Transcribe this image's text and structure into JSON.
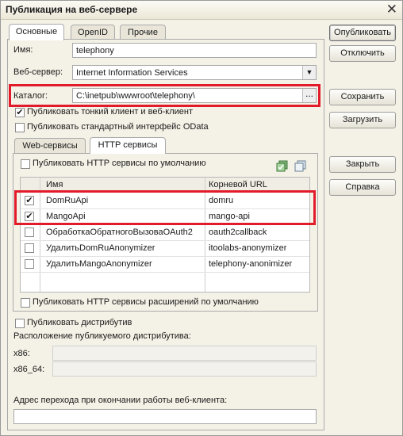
{
  "window": {
    "title": "Публикация на веб-сервере",
    "close_symbol": "✕"
  },
  "tabs": [
    {
      "label": "Основные",
      "active": true
    },
    {
      "label": "OpenID",
      "active": false
    },
    {
      "label": "Прочие",
      "active": false
    }
  ],
  "form": {
    "name_label": "Имя:",
    "name_value": "telephony",
    "webserver_label": "Веб-сервер:",
    "webserver_value": "Internet Information Services",
    "catalog_label": "Каталог:",
    "catalog_value": "C:\\inetpub\\wwwroot\\telephony\\",
    "ellipsis": "...",
    "publish_thin_client": {
      "label": "Публиковать тонкий клиент и веб-клиент",
      "checked": true
    },
    "publish_odata": {
      "label": "Публиковать стандартный интерфейс OData",
      "checked": false
    }
  },
  "inner_tabs": [
    {
      "label": "Web-сервисы",
      "active": false
    },
    {
      "label": "HTTP сервисы",
      "active": true
    }
  ],
  "http": {
    "publish_default": {
      "label": "Публиковать HTTP сервисы по умолчанию",
      "checked": false
    },
    "columns": {
      "name": "Имя",
      "root_url": "Корневой URL"
    },
    "rows": [
      {
        "checked": true,
        "name": "DomRuApi",
        "url": "domru"
      },
      {
        "checked": true,
        "name": "MangoApi",
        "url": "mango-api"
      },
      {
        "checked": false,
        "name": "ОбработкаОбратногоВызоваOAuth2",
        "url": "oauth2callback"
      },
      {
        "checked": false,
        "name": "УдалитьDomRuAnonymizer",
        "url": "itoolabs-anonymizer"
      },
      {
        "checked": false,
        "name": "УдалитьMangoAnonymizer",
        "url": "telephony-anonimizer"
      }
    ],
    "publish_ext_default": {
      "label": "Публиковать HTTP сервисы расширений по умолчанию",
      "checked": false
    }
  },
  "distrib": {
    "publish": {
      "label": "Публиковать дистрибутив",
      "checked": false
    },
    "location_label": "Расположение публикуемого дистрибутива:",
    "x86_label": "x86:",
    "x86_value": "",
    "x86_64_label": "x86_64:",
    "x86_64_value": ""
  },
  "exit_url": {
    "label": "Адрес перехода при окончании работы веб-клиента:",
    "value": ""
  },
  "buttons": {
    "publish": "Опубликовать",
    "disable": "Отключить",
    "save": "Сохранить",
    "load": "Загрузить",
    "close": "Закрыть",
    "help": "Справка"
  },
  "check_symbol": "✔",
  "colors": {
    "highlight": "#e21b2b",
    "panel": "#f4f1e6"
  }
}
